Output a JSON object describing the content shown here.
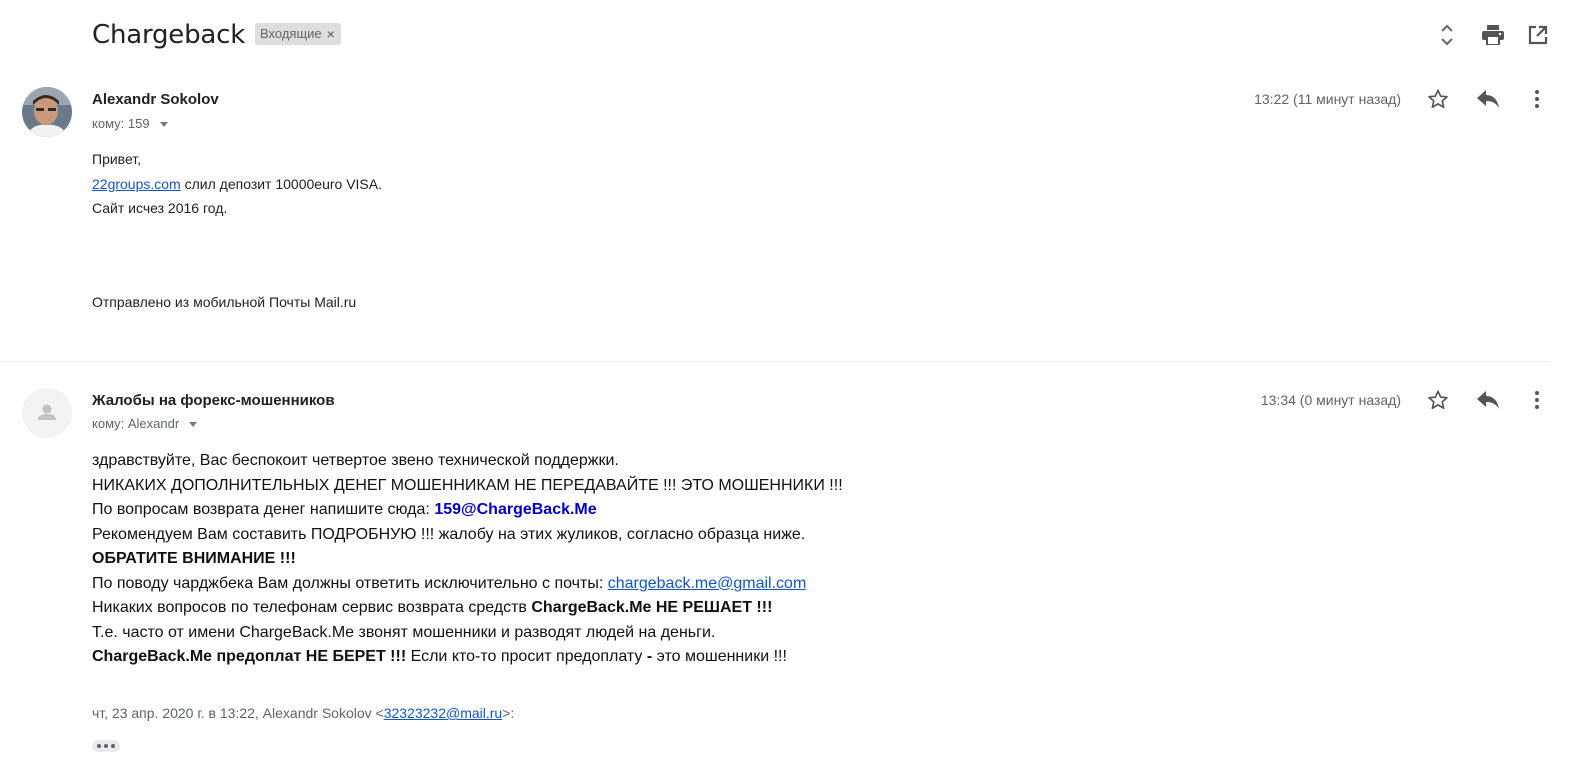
{
  "header": {
    "subject": "Chargeback",
    "label": "Входящие",
    "label_remove": "×",
    "icons": [
      "expand-collapse-icon",
      "print-icon",
      "open-in-new-window-icon"
    ]
  },
  "messages": [
    {
      "sender": "Alexandr Sokolov",
      "to_line": "кому: 159",
      "time": "13:22 (11 минут назад)",
      "body": {
        "line1": "Привет,",
        "line2_link": "22groups.com",
        "line2_rest": " слил депозит 10000euro VISA.",
        "line3": "Сайт исчез 2016 год.",
        "signature": "Отправлено из мобильной Почты Mail.ru"
      }
    },
    {
      "sender": "Жалобы на форекс-мошенников",
      "to_line": "кому: Alexandr",
      "time": "13:34 (0 минут назад)",
      "body": {
        "l1": "здравствуйте, Вас беспокоит четвертое звено технической поддержки.",
        "l2": "НИКАКИХ ДОПОЛНИТЕЛЬНЫХ ДЕНЕГ МОШЕННИКАМ НЕ ПЕРЕДАВАЙТЕ !!! ЭТО МОШЕННИКИ !!!",
        "l3_text": "По вопросам возврата денег напишите сюда: ",
        "l3_email": "159@ChargeBack.Me",
        "l4": "Рекомендуем Вам составить ПОДРОБНУЮ !!! жалобу на этих жуликов, согласно образца ниже.",
        "l5": "ОБРАТИТЕ ВНИМАНИЕ !!!",
        "l6_text": "По поводу чарджбека Вам должны ответить исключительно с почты: ",
        "l6_link": "chargeback.me@gmail.com",
        "l7_text": "Никаких вопросов по телефонам сервис возврата средств ",
        "l7_bold": "ChargeBack.Me НЕ РЕШАЕТ !!!",
        "l8": "Т.е. часто от имени ChargeBack.Me звонят мошенники и разводят людей на деньги.",
        "l9_bold1": "ChargeBack.Me предоплат НЕ БЕРЕТ !!!",
        "l9_text": " Если кто-то просит предоплату ",
        "l9_dash": "-",
        "l9_text2": " это мошенники !!!",
        "quote_prefix": "чт, 23 апр. 2020 г. в 13:22, Alexandr Sokolov <",
        "quote_email": "32323232@mail.ru",
        "quote_suffix": ">:"
      }
    }
  ]
}
